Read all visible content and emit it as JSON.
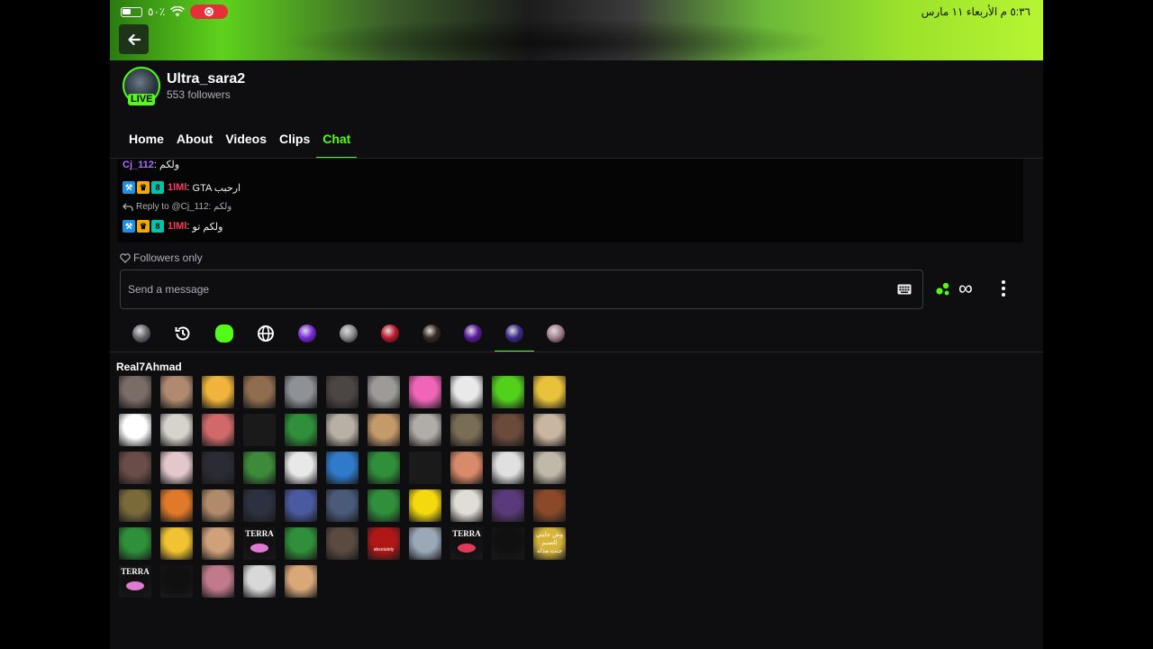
{
  "status_bar": {
    "time_date": "٥:٣٦ م  الأربعاء ١١ مارس",
    "battery": "٥٠٪"
  },
  "channel": {
    "name": "Ultra_sara2",
    "followers": "553 followers",
    "live_label": "LIVE"
  },
  "tabs": [
    {
      "label": "Home"
    },
    {
      "label": "About"
    },
    {
      "label": "Videos"
    },
    {
      "label": "Clips"
    },
    {
      "label": "Chat",
      "active": true
    }
  ],
  "chat": {
    "messages": [
      {
        "user": "Cj_112",
        "user_color": "#a970ff",
        "text": "ولكم"
      },
      {
        "user": "1lMl",
        "user_color": "#ff3b5c",
        "text": "GTA ارحبب"
      },
      {
        "reply_prefix": "Reply to @Cj_112:",
        "reply_text": "ولكم"
      },
      {
        "user": "1lMl",
        "user_color": "#ff3b5c",
        "text": "ولكم تو"
      }
    ]
  },
  "followers_only": "Followers only",
  "input": {
    "placeholder": "Send a message",
    "value": ""
  },
  "tools": {
    "infinity": "∞"
  },
  "emote_tabs": [
    {
      "icon": "channel-avatar-icon",
      "color": "#6a6a72"
    },
    {
      "icon": "history-icon",
      "color": "#ffffff"
    },
    {
      "icon": "kick-emote-icon",
      "color": "#53fc18"
    },
    {
      "icon": "globe-icon",
      "color": "#ffffff"
    },
    {
      "icon": "channel-emote-icon",
      "color": "#7a2bd9"
    },
    {
      "icon": "channel-emote-icon",
      "color": "#8a8a8a"
    },
    {
      "icon": "channel-emote-icon",
      "color": "#c01a2a"
    },
    {
      "icon": "channel-emote-icon",
      "color": "#3a2a20"
    },
    {
      "icon": "channel-emote-icon",
      "color": "#5b1aa0"
    },
    {
      "icon": "channel-emote-icon",
      "color": "#3d2a8a",
      "active": true
    },
    {
      "icon": "channel-emote-icon",
      "color": "#a88090"
    }
  ],
  "emote_set_title": "Real7Ahmad",
  "emote_texts": {
    "terra": "TERRA",
    "absolute": "absolutely",
    "waw": "وش جايبي للصيم جنت مذلة"
  },
  "emote_colors": [
    "#7a6c66",
    "#b08a70",
    "#f0b43a",
    "#8f6d4e",
    "#8e9196",
    "#4b4643",
    "#9e9a98",
    "#f065b8",
    "#e9e9e9",
    "#53d01c",
    "#e8c23a",
    "#ffffff",
    "#d6d2cc",
    "#d06a6a",
    "#1a1a1a",
    "#2f8f3a",
    "#b8b0a5",
    "#c49a6a",
    "#b0aca8",
    "#7a6d55",
    "#6a4a3a",
    "#c8b6a0",
    "#6a4c48",
    "#e4c7cc",
    "#2b2b35",
    "#3d8a3a",
    "#e8e8e8",
    "#2f7acb",
    "#2f8f3a",
    "#1a1a1a",
    "#d98a6a",
    "#e0e0e0",
    "#c0b8a8",
    "#7a6a3a",
    "#e07a2a",
    "#b08a6a",
    "#2c3040",
    "#4a5aa0",
    "#4a5a7a",
    "#2f8f3a",
    "#f4d90f",
    "#e0ddd6",
    "#5a3a7a",
    "#8a4a2a",
    "#2f8f3a",
    "#f1c232",
    "#cfa07a",
    "#101010",
    "#2f8f3a",
    "#5a4a40",
    "#b01818",
    "#9aa8b8",
    "#101010",
    "#101010",
    "#d6b43a",
    "#101010",
    "#101010",
    "#c07a8a",
    "#d8d8d8",
    "#d9a878"
  ]
}
